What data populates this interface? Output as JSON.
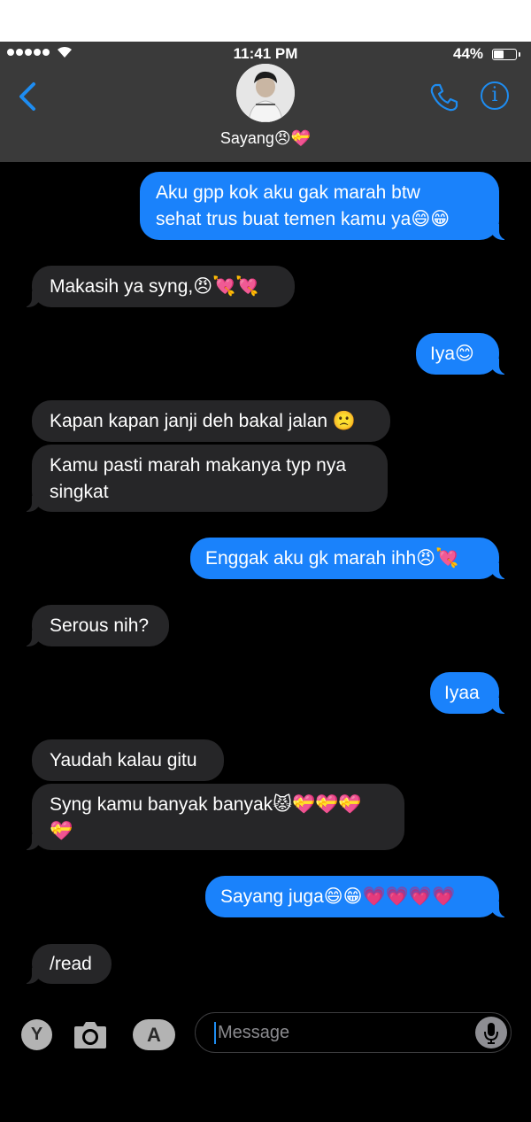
{
  "status_bar": {
    "time": "11:41 PM",
    "battery": "44%"
  },
  "contact": {
    "name": "Sayang😠💝"
  },
  "messages": [
    {
      "dir": "out",
      "text": "Aku gpp kok aku gak marah btw\nsehat trus buat temen kamu ya😄😁"
    },
    {
      "dir": "in",
      "text": "Makasih ya syng,😠💘💘"
    },
    {
      "dir": "out",
      "text": "Iya😊"
    },
    {
      "dir": "in",
      "text": "Kapan kapan janji deh bakal jalan 🙁"
    },
    {
      "dir": "in",
      "text": "Kamu pasti marah makanya typ nya\nsingkat"
    },
    {
      "dir": "out",
      "text": "Enggak aku gk marah ihh😠💘"
    },
    {
      "dir": "in",
      "text": "Serous nih?"
    },
    {
      "dir": "out",
      "text": "Iyaa"
    },
    {
      "dir": "in",
      "text": "Yaudah kalau gitu"
    },
    {
      "dir": "in",
      "text": "Syng kamu banyak banyak😾💝💝💝\n💝"
    },
    {
      "dir": "out",
      "text": "Sayang juga😄😁💗💗💗💗"
    },
    {
      "dir": "in",
      "text": "/read"
    }
  ],
  "composer": {
    "placeholder": "Message",
    "app_letter": "Y"
  },
  "colors": {
    "outgoing": "#1a82fb",
    "incoming": "#262628",
    "accent": "#1e8cf0"
  }
}
